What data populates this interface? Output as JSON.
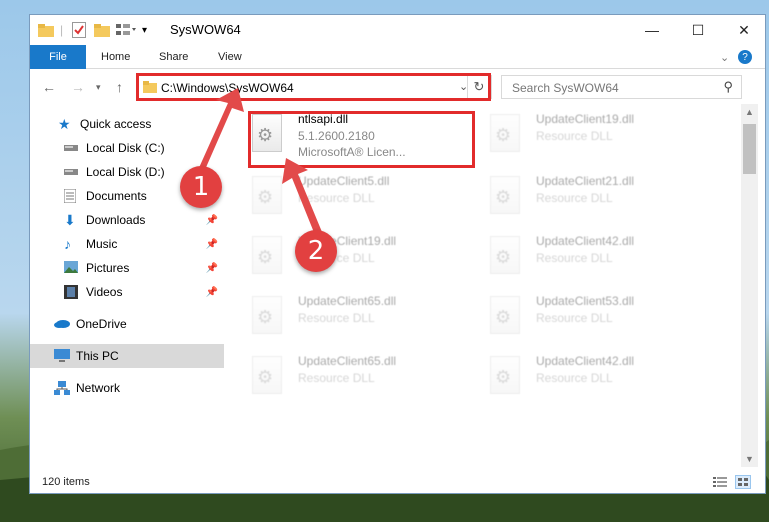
{
  "window": {
    "title": "SysWOW64",
    "min_label": "—",
    "max_label": "☐",
    "close_label": "✕"
  },
  "ribbon": {
    "tabs": [
      "File",
      "Home",
      "Share",
      "View"
    ],
    "expand_label": "⌄",
    "help_label": "?"
  },
  "address": {
    "path": "C:\\Windows\\SysWOW64",
    "search_placeholder": "Search SysWOW64"
  },
  "sidebar": {
    "items": [
      {
        "label": "Quick access",
        "icon": "star-icon"
      },
      {
        "label": "Local Disk (C:)",
        "icon": "drive-icon"
      },
      {
        "label": "Local Disk (D:)",
        "icon": "drive-icon"
      },
      {
        "label": "Documents",
        "icon": "documents-icon",
        "pinned": true
      },
      {
        "label": "Downloads",
        "icon": "download-icon",
        "pinned": true
      },
      {
        "label": "Music",
        "icon": "music-icon",
        "pinned": true
      },
      {
        "label": "Pictures",
        "icon": "pictures-icon",
        "pinned": true
      },
      {
        "label": "Videos",
        "icon": "videos-icon",
        "pinned": true
      },
      {
        "label": "OneDrive",
        "icon": "cloud-icon"
      },
      {
        "label": "This PC",
        "icon": "computer-icon",
        "selected": true
      },
      {
        "label": "Network",
        "icon": "network-icon"
      }
    ]
  },
  "files": [
    {
      "name": "ntlsapi.dll",
      "line1": "5.1.2600.2180",
      "line2": "MicrosoftA® Licen...",
      "highlighted": true
    },
    {
      "name": "UpdateClient19.dll",
      "line1": "Resource DLL"
    },
    {
      "name": "UpdateClient5.dll",
      "line1": "Resource DLL"
    },
    {
      "name": "UpdateClient21.dll",
      "line1": "Resource DLL"
    },
    {
      "name": "UpdateClient19.dll",
      "line1": "Resource DLL"
    },
    {
      "name": "UpdateClient42.dll",
      "line1": "Resource DLL"
    },
    {
      "name": "UpdateClient65.dll",
      "line1": "Resource DLL"
    },
    {
      "name": "UpdateClient53.dll",
      "line1": "Resource DLL"
    },
    {
      "name": "UpdateClient65.dll",
      "line1": "Resource DLL"
    },
    {
      "name": "UpdateClient42.dll",
      "line1": "Resource DLL"
    }
  ],
  "status": {
    "item_count": "120 items"
  },
  "annotations": {
    "step1": "1",
    "step2": "2",
    "color": "#e22b2b"
  }
}
